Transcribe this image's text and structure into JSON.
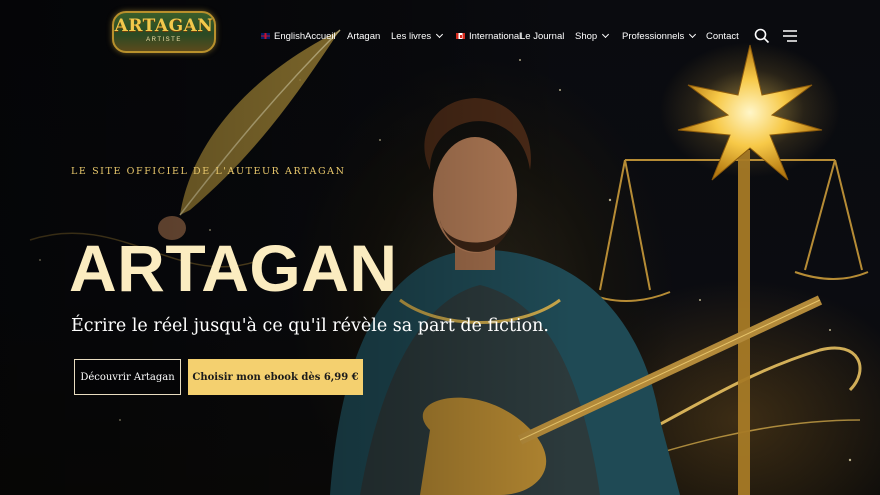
{
  "brand": {
    "logo_text": "ARTAGAN",
    "logo_subtext": "ARTISTE"
  },
  "nav": {
    "english": "English",
    "accueil": "Accueil",
    "artagan": "Artagan",
    "livres": "Les livres",
    "international": "International",
    "journal": "Le Journal",
    "shop": "Shop",
    "professionnels": "Professionnels",
    "contact": "Contact"
  },
  "icons": {
    "search": "search-icon",
    "menu": "menu-icon",
    "flag_en": "uk-flag-icon",
    "flag_intl": "canada-flag-icon"
  },
  "hero": {
    "eyebrow": "Le site officiel de l'auteur Artagan",
    "title": "ARTAGAN",
    "tagline": "Écrire le réel jusqu'à ce qu'il révèle sa part de fiction.",
    "cta_primary": "Découvrir Artagan",
    "cta_secondary": "Choisir mon ebook dès 6,99 €"
  },
  "colors": {
    "accent_gold": "#f4d06f",
    "title_cream": "#fbecc0",
    "eyebrow_gold": "#e9c86c",
    "background": "#07080b"
  }
}
